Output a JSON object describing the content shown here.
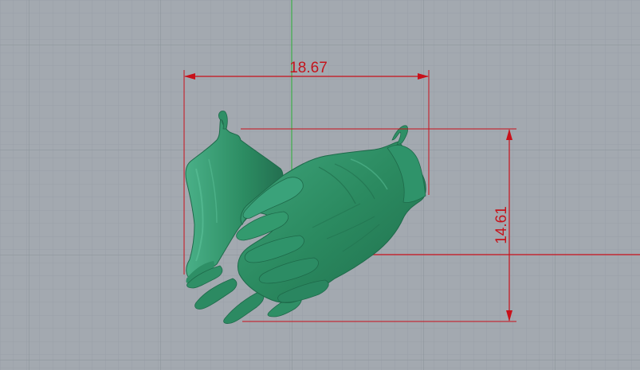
{
  "viewport": {
    "background": "#a3a9b0",
    "grid_minor_color": "#98a0a7",
    "grid_major_color": "#8c949b",
    "y_axis_color": "#3fae4a",
    "x_axis_color": "#c8101a"
  },
  "model": {
    "name": "hands",
    "color": "#2f8f66"
  },
  "dimensions": {
    "color": "#c8101a",
    "horizontal": {
      "value": "18.67"
    },
    "vertical": {
      "value": "14.61"
    }
  }
}
